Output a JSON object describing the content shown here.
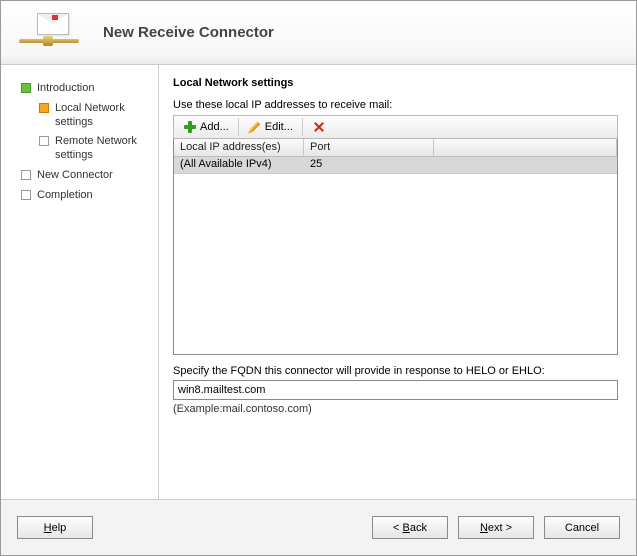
{
  "header": {
    "title": "New Receive Connector"
  },
  "sidebar": {
    "items": [
      {
        "label": "Introduction",
        "state": "done"
      },
      {
        "label": "Local Network settings",
        "state": "current",
        "sub": true
      },
      {
        "label": "Remote Network settings",
        "state": "pending",
        "sub": true
      },
      {
        "label": "New Connector",
        "state": "pending"
      },
      {
        "label": "Completion",
        "state": "pending"
      }
    ]
  },
  "main": {
    "section_title": "Local Network settings",
    "instruction": "Use these local IP addresses to receive mail:",
    "toolbar": {
      "add": "Add...",
      "edit": "Edit...",
      "delete_icon": "delete"
    },
    "columns": {
      "ip": "Local IP address(es)",
      "port": "Port"
    },
    "rows": [
      {
        "ip": "(All Available IPv4)",
        "port": "25"
      }
    ],
    "fqdn_label": "Specify the FQDN this connector will provide in response to HELO or EHLO:",
    "fqdn_value": "win8.mailtest.com",
    "fqdn_example": "(Example:mail.contoso.com)"
  },
  "footer": {
    "help": "Help",
    "back": "Back",
    "next": "Next",
    "cancel": "Cancel"
  }
}
